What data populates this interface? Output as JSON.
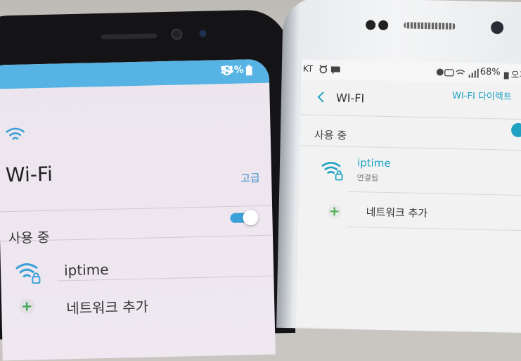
{
  "left_phone": {
    "status": {
      "battery": "54%"
    },
    "title": "Wi-Fi",
    "advanced": "고급",
    "in_use": "사용 중",
    "toggle_on": true,
    "network_name": "iptime",
    "add_network": "네트워크 추가",
    "colors": {
      "status_bar": "#56b3e3",
      "accent": "#3aa0d8"
    },
    "icons": [
      "wifi-icon",
      "battery-icon",
      "dnd-icon",
      "wifi-lock-icon",
      "plus-icon"
    ]
  },
  "right_phone": {
    "status": {
      "carrier": "KT",
      "battery": "68%",
      "time_partial": "오후"
    },
    "title": "WI-FI",
    "wifi_direct": "WI-FI 다이렉트",
    "in_use": "사용 중",
    "network_name": "iptime",
    "network_status": "연결됨",
    "add_network": "네트워크 추가",
    "colors": {
      "accent": "#1fa2c4",
      "plus": "#4caf50"
    },
    "icons": [
      "back-chevron-icon",
      "wifi-lock-icon",
      "plus-icon",
      "message-icon",
      "signal-icon"
    ]
  }
}
